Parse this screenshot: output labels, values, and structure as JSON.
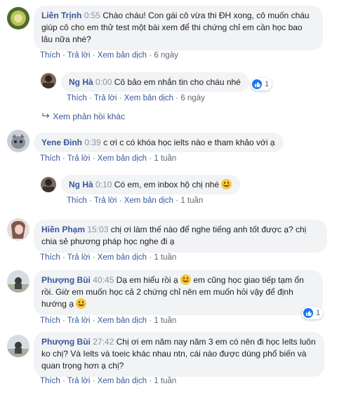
{
  "actions": {
    "like": "Thích",
    "reply": "Trả lời",
    "translate": "Xem bản dịch",
    "sep": "·"
  },
  "comments": [
    {
      "name": "Liên Trịnh",
      "timestamp": "0:55",
      "text": "Chào cháu! Con gái cô vừa thi ĐH xong, cô muốn cháu giúp cô cho em thử test một bài xem để thi chứng chỉ em cần học bao lâu nữa nhé?",
      "age": "6 ngày"
    },
    {
      "name": "Ng Hà",
      "timestamp": "0:00",
      "text": "Cô bảo em nhắn tin cho cháu nhé",
      "age": "6 ngày",
      "reaction_count": "1"
    },
    {
      "name": "Yene Đinh",
      "timestamp": "0:39",
      "text": "c ơi c có khóa học ielts nào e tham khảo với ạ",
      "age": "1 tuần"
    },
    {
      "name": "Ng Hà",
      "timestamp": "0:10",
      "text": "Có em, em inbox hộ chị nhé",
      "age": "1 tuần"
    },
    {
      "name": "Hiền Phạm",
      "timestamp": "15:03",
      "text": "chị ơi làm thế nào để nghe tiếng anh tốt được ạ? chị chia sẻ phương pháp học nghe đi ạ",
      "age": "1 tuần"
    },
    {
      "name": "Phượng Bùi",
      "timestamp": "40:45",
      "text_a": "Dạ em hiểu rồi ạ",
      "text_b": "em cũng học giao tiếp tạm ổn rồi. Giờ em muốn học cả 2 chứng chỉ nên em muốn hỏi vậy để định hướng ạ",
      "age": "1 tuần",
      "reaction_count": "1"
    },
    {
      "name": "Phượng Bùi",
      "timestamp": "27:42",
      "text": "Chị ơi em năm nay năm 3 em có nên đi học Ielts luôn ko chị? Và Ielts và toeic khác nhau ntn, cái nào được dùng phổ biến và quan trọng hơn ạ chị?",
      "age": "1 tuần"
    }
  ],
  "more_replies": "Xem phản hồi khác",
  "colors": {
    "link": "#385898",
    "bubble": "#f2f3f5",
    "like": "#1877f2"
  },
  "icons": {
    "reply_arrow": "reply-arrow-icon",
    "emoji": "smiley-emoji-icon",
    "like": "thumbs-up-icon"
  }
}
